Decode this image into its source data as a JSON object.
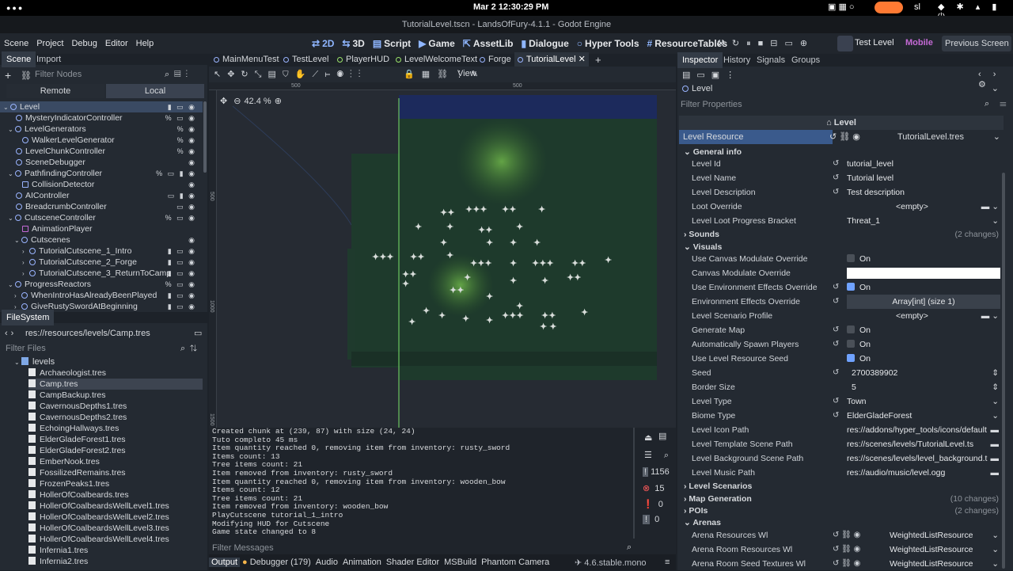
{
  "topbar": {
    "datetime": "Mar 2  12:30:29 PM",
    "tray_label": "sl"
  },
  "window": {
    "title": "TutorialLevel.tscn - LandsOfFury-4.1.1 - Godot Engine"
  },
  "menus": [
    "Scene",
    "Project",
    "Debug",
    "Editor",
    "Help"
  ],
  "workspaces": {
    "w2d": "2D",
    "w3d": "3D",
    "script": "Script",
    "game": "Game",
    "assetlib": "AssetLib",
    "dialogue": "Dialogue",
    "hyper": "Hyper Tools",
    "resource": "ResourceTables"
  },
  "run": {
    "test_level": "Test Level",
    "renderer": "Mobile",
    "prev_screen": "Previous Screen"
  },
  "scene_dock": {
    "tabs": [
      "Scene",
      "Import"
    ],
    "filter_placeholder": "Filter Nodes",
    "remote": "Remote",
    "local": "Local",
    "nodes": [
      "Level",
      "MysteryIndicatorController",
      "LevelGenerators",
      "WalkerLevelGenerator",
      "LevelChunkController",
      "SceneDebugger",
      "PathfindingController",
      "CollisionDetector",
      "AIController",
      "BreadcrumbController",
      "CutsceneController",
      "AnimationPlayer",
      "Cutscenes",
      "TutorialCutscene_1_Intro",
      "TutorialCutscene_2_Forge",
      "TutorialCutscene_3_ReturnToCamp",
      "ProgressReactors",
      "WhenIntroHasAlreadyBeenPlayed",
      "GiveRustySwordAtBeginning"
    ]
  },
  "filesystem": {
    "title": "FileSystem",
    "path": "res://resources/levels/Camp.tres",
    "filter_placeholder": "Filter Files",
    "folder": "levels",
    "files": [
      "Archaeologist.tres",
      "Camp.tres",
      "CampBackup.tres",
      "CavernousDepths1.tres",
      "CavernousDepths2.tres",
      "EchoingHallways.tres",
      "ElderGladeForest1.tres",
      "ElderGladeForest2.tres",
      "EmberNook.tres",
      "FossilizedRemains.tres",
      "FrozenPeaks1.tres",
      "HollerOfCoalbeards.tres",
      "HollerOfCoalbeardsWellLevel1.tres",
      "HollerOfCoalbeardsWellLevel2.tres",
      "HollerOfCoalbeardsWellLevel3.tres",
      "HollerOfCoalbeardsWellLevel4.tres",
      "Infernia1.tres",
      "Infernia2.tres"
    ]
  },
  "scene_tabs": [
    "MainMenuTest",
    "TestLevel",
    "PlayerHUD",
    "LevelWelcomeText",
    "Forge",
    "TutorialLevel"
  ],
  "viewport": {
    "view_label": "View",
    "zoom": "42.4 %",
    "ruler_top": [
      "500",
      "500"
    ],
    "ruler_left": [
      "500",
      "1000",
      "1500"
    ]
  },
  "output": {
    "lines": [
      "Created chunk at (239, 87) with size (24, 24)",
      "Tuto completo 45 ms",
      "Item quantity reached 0, removing item from inventory: rusty_sword",
      "Items count: 13",
      "Tree items count: 21",
      "Item removed from inventory: rusty_sword",
      "Item quantity reached 0, removing item from inventory: wooden_bow",
      "Items count: 12",
      "Tree items count: 21",
      "Item removed from inventory: wooden_bow",
      "PlayCutscene tutorial_1_intro",
      "Modifying HUD for Cutscene",
      "Game state changed to 8"
    ],
    "filter_placeholder": "Filter Messages",
    "counts": [
      "1156",
      "15",
      "0",
      "0"
    ]
  },
  "bottom_tabs": [
    "Output",
    "Debugger (179)",
    "Audio",
    "Animation",
    "Shader Editor",
    "MSBuild",
    "Phantom Camera"
  ],
  "version": "4.6.stable.mono",
  "inspector": {
    "tabs": [
      "Inspector",
      "History",
      "Signals",
      "Groups"
    ],
    "node": "Level",
    "filter_placeholder": "Filter Properties",
    "class_title": "Level",
    "resource_label": "Level Resource",
    "resource_value": "TutorialLevel.tres",
    "sections": {
      "general": "General info",
      "sounds": "Sounds",
      "sounds_changes": "(2 changes)",
      "visuals": "Visuals",
      "scenarios": "Level Scenarios",
      "mapgen": "Map Generation",
      "mapgen_changes": "(10 changes)",
      "pois": "POIs",
      "pois_changes": "(2 changes)",
      "arenas": "Arenas"
    },
    "general": [
      {
        "label": "Level Id",
        "value": "tutorial_level"
      },
      {
        "label": "Level Name",
        "value": "Tutorial level"
      },
      {
        "label": "Level Description",
        "value": "Test description"
      },
      {
        "label": "Loot Override",
        "value": "<empty>"
      },
      {
        "label": "Level Loot Progress Bracket",
        "value": "Threat_1"
      }
    ],
    "visuals": [
      {
        "label": "Use Canvas Modulate Override",
        "value": "On"
      },
      {
        "label": "Canvas Modulate Override",
        "value": ""
      },
      {
        "label": "Use Environment Effects Override",
        "value": "On"
      },
      {
        "label": "Environment Effects Override",
        "value": "Array[int] (size 1)"
      },
      {
        "label": "Level Scenario Profile",
        "value": "<empty>"
      },
      {
        "label": "Generate Map",
        "value": "On"
      },
      {
        "label": "Automatically Spawn Players",
        "value": "On"
      },
      {
        "label": "Use Level Resource Seed",
        "value": "On"
      },
      {
        "label": "Seed",
        "value": "2700389902"
      },
      {
        "label": "Border Size",
        "value": "5"
      },
      {
        "label": "Level Type",
        "value": "Town"
      },
      {
        "label": "Biome Type",
        "value": "ElderGladeForest"
      },
      {
        "label": "Level Icon Path",
        "value": "res://addons/hyper_tools/icons/default"
      },
      {
        "label": "Level Template Scene Path",
        "value": "res://scenes/levels/TutorialLevel.ts"
      },
      {
        "label": "Level Background Scene Path",
        "value": "res://scenes/levels/level_background.t"
      },
      {
        "label": "Level Music Path",
        "value": "res://audio/music/level.ogg"
      }
    ],
    "arenas": [
      {
        "label": "Arena Resources Wl",
        "value": "WeightedListResource"
      },
      {
        "label": "Arena Room Resources Wl",
        "value": "WeightedListResource"
      },
      {
        "label": "Arena Room Seed Textures Wl",
        "value": "WeightedListResource"
      }
    ]
  },
  "colors": {
    "accent": "#6fa2ff",
    "selected_row": "#3a4a63",
    "bg": "#1d2229"
  }
}
